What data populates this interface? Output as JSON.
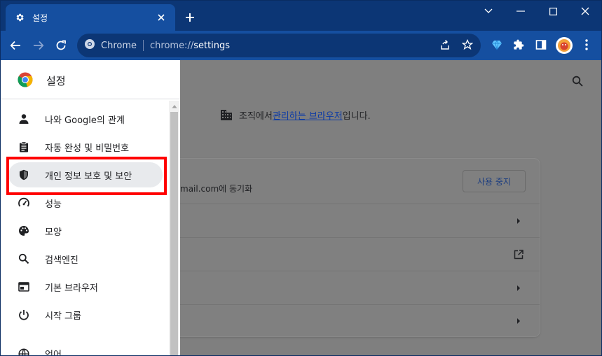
{
  "tab": {
    "title": "설정",
    "icon": "gear-icon"
  },
  "window": {
    "controls": [
      "chevron-down-icon",
      "minimize-icon",
      "maximize-icon",
      "close-icon"
    ]
  },
  "omnibox": {
    "site_label": "Chrome",
    "url_scheme": "chrome://",
    "url_path": "settings"
  },
  "toolbar_icons": [
    "back-arrow-icon",
    "forward-arrow-icon",
    "reload-icon",
    "share-icon",
    "bookmark-star-icon",
    "extension-gem-icon",
    "extensions-puzzle-icon",
    "side-panel-icon",
    "profile-avatar-icon",
    "menu-kebab-icon"
  ],
  "drawer": {
    "title": "설정",
    "items": [
      {
        "label": "나와 Google의 관계",
        "icon": "person-icon"
      },
      {
        "label": "자동 완성 및 비밀번호",
        "icon": "clipboard-icon"
      },
      {
        "label": "개인 정보 보호 및 보안",
        "icon": "shield-icon",
        "active": true
      },
      {
        "label": "성능",
        "icon": "speedometer-icon"
      },
      {
        "label": "모양",
        "icon": "palette-icon"
      },
      {
        "label": "검색엔진",
        "icon": "search-icon"
      },
      {
        "label": "기본 브라우저",
        "icon": "browser-window-icon"
      },
      {
        "label": "시작 그룹",
        "icon": "power-icon"
      },
      {
        "label": "언어",
        "icon": "globe-icon"
      }
    ]
  },
  "page": {
    "managed_prefix": "조직에서 ",
    "managed_link": "관리하는 브라우저",
    "managed_suffix": "입니다.",
    "sync_text": "mail.com에 동기화",
    "stop_sync_button": "사용 중지"
  },
  "colors": {
    "titlebar": "#0c3675",
    "toolbar": "#154fa0",
    "highlight": "#ff0000",
    "link": "#0b3aa6"
  }
}
